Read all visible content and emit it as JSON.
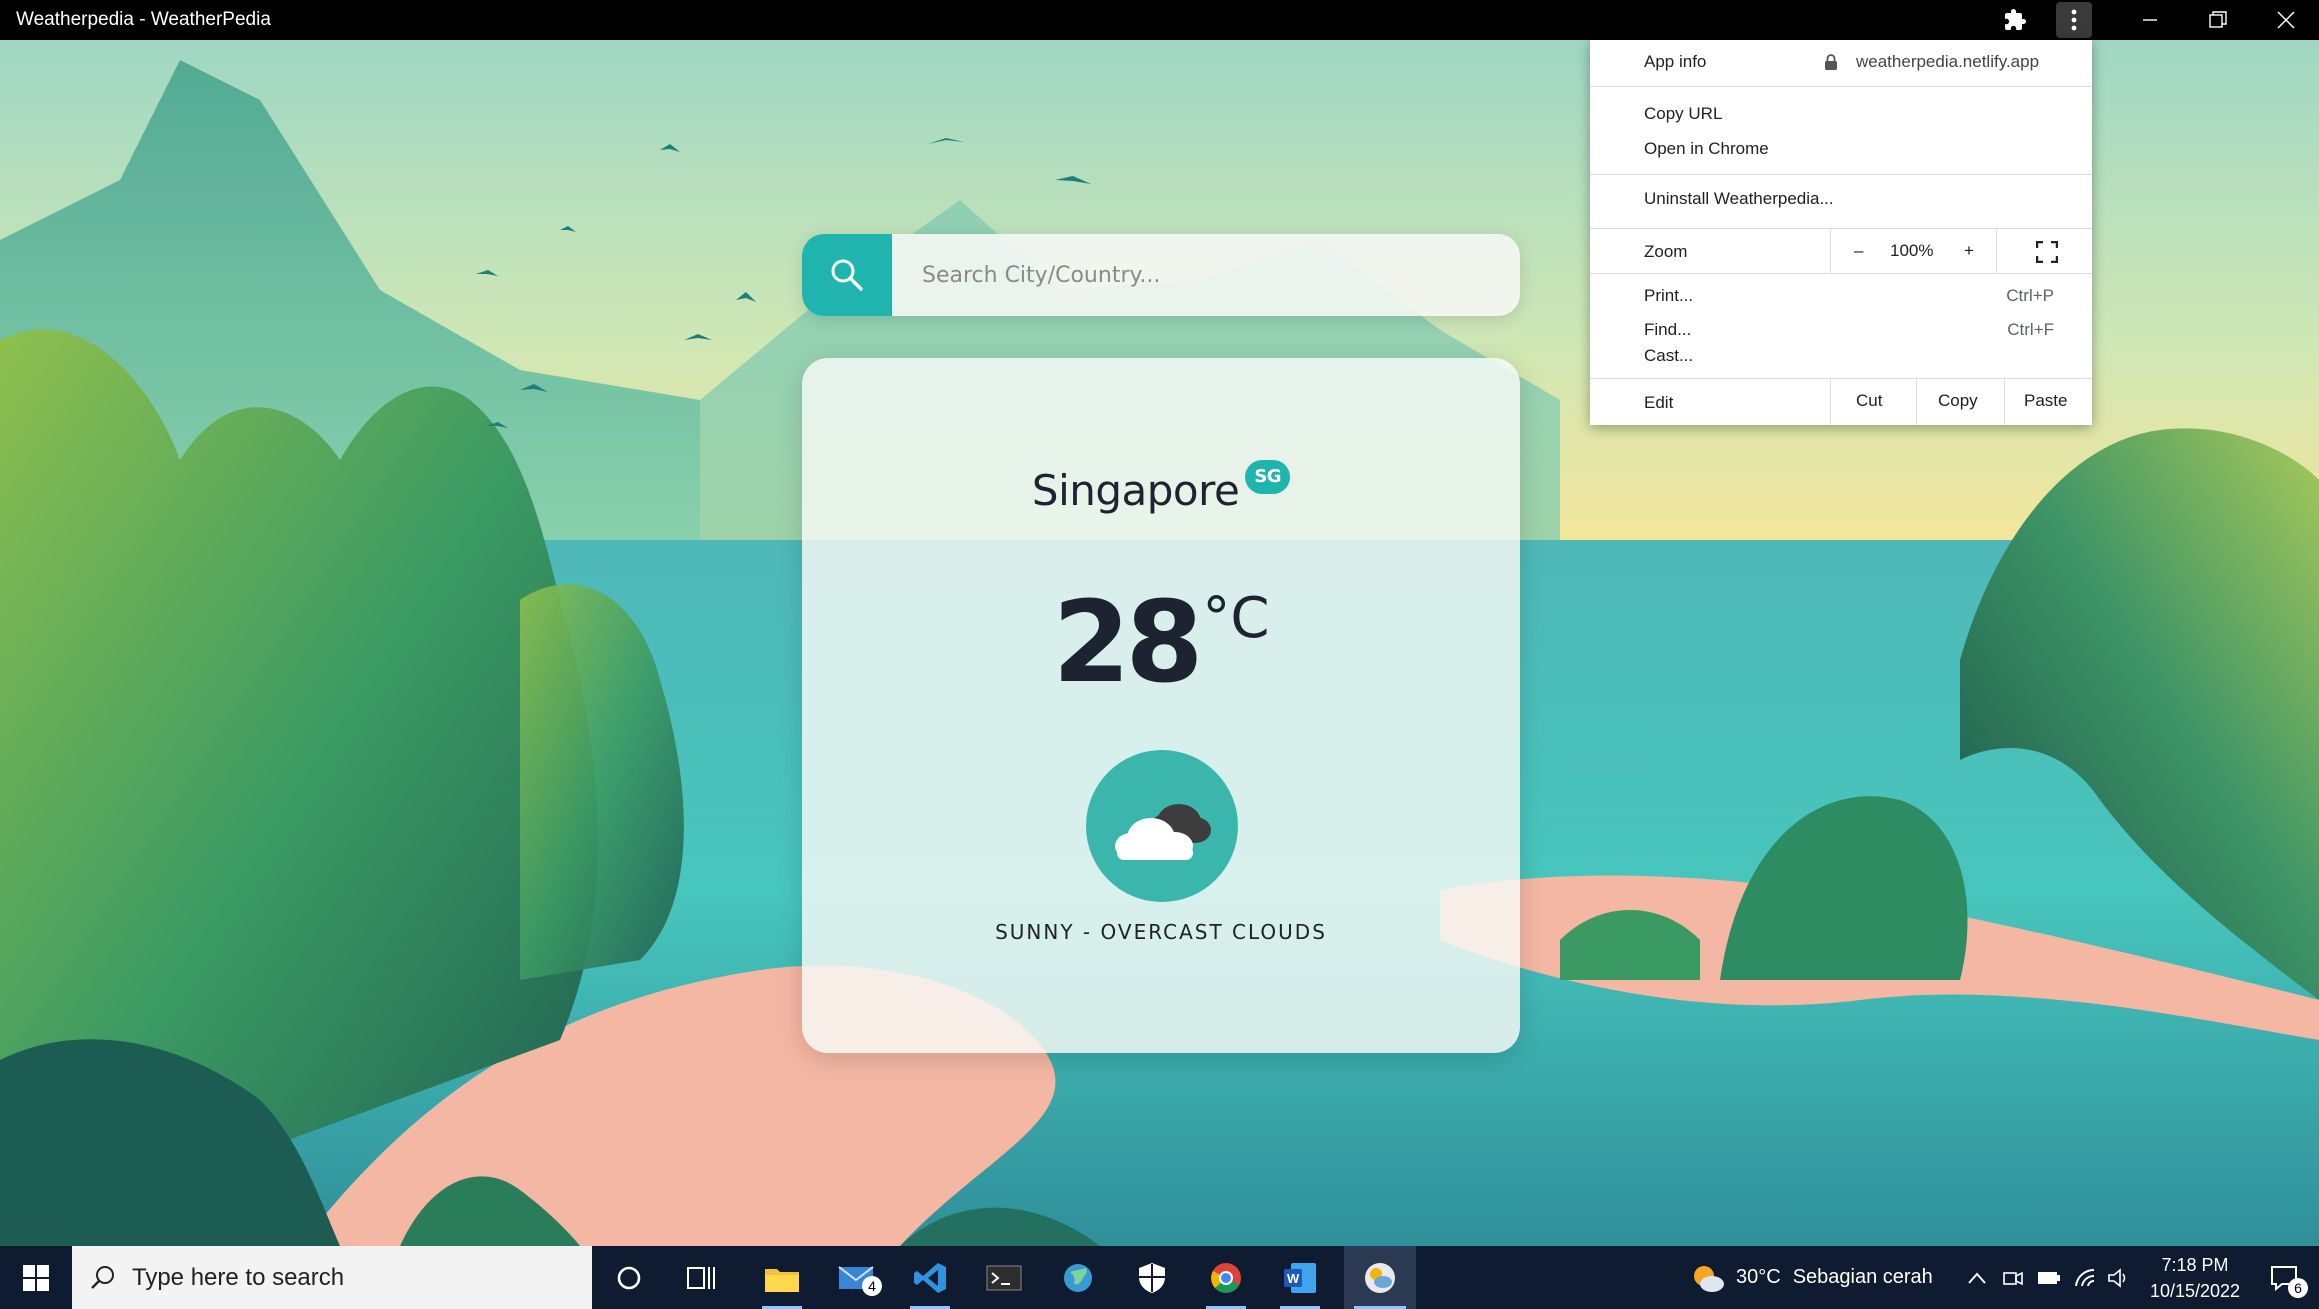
{
  "window": {
    "title": "Weatherpedia - WeatherPedia",
    "controls": [
      "extensions-icon",
      "menu-kebab-icon",
      "minimize-icon",
      "restore-icon",
      "close-icon"
    ]
  },
  "search": {
    "placeholder": "Search City/Country...",
    "value": ""
  },
  "weather": {
    "city": "Singapore",
    "country_code": "SG",
    "temperature": "28",
    "unit": "°C",
    "description": "SUNNY - OVERCAST CLOUDS",
    "icon": "cloud-icon"
  },
  "menu": {
    "app_info": "App info",
    "url": "weatherpedia.netlify.app",
    "copy_url": "Copy URL",
    "open_in_chrome": "Open in Chrome",
    "uninstall": "Uninstall Weatherpedia...",
    "zoom_label": "Zoom",
    "zoom_minus": "–",
    "zoom_value": "100%",
    "zoom_plus": "+",
    "print": "Print...",
    "print_shortcut": "Ctrl+P",
    "find": "Find...",
    "find_shortcut": "Ctrl+F",
    "cast": "Cast...",
    "edit": "Edit",
    "cut": "Cut",
    "copy": "Copy",
    "paste": "Paste"
  },
  "taskbar": {
    "search_placeholder": "Type here to search",
    "mail_badge": "4",
    "weather_temp": "30°C",
    "weather_text": "Sebagian cerah",
    "time": "7:18 PM",
    "date": "10/15/2022",
    "notifications": "6"
  },
  "colors": {
    "accent": "#1fb4ad",
    "taskbar": "#0e1b30",
    "titlebar": "#000000"
  }
}
